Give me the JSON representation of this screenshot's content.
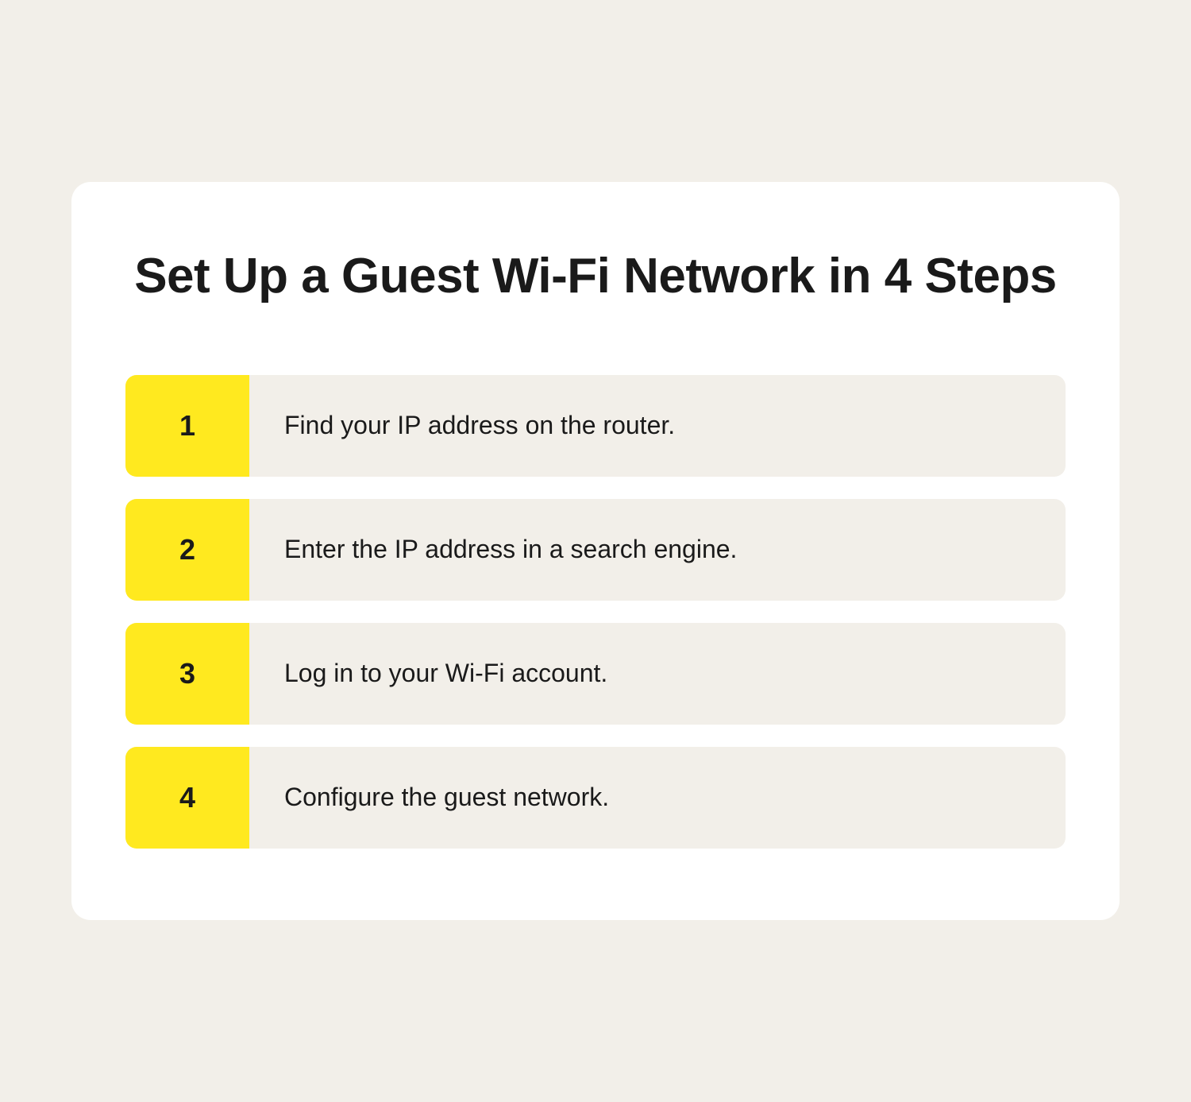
{
  "title": "Set Up a Guest Wi-Fi Network in 4 Steps",
  "colors": {
    "background": "#f2efe9",
    "card": "#ffffff",
    "accent": "#ffe91f",
    "text": "#1a1a1a"
  },
  "steps": [
    {
      "number": "1",
      "text": "Find your IP address on the router."
    },
    {
      "number": "2",
      "text": "Enter the IP address in a search engine."
    },
    {
      "number": "3",
      "text": "Log in to your Wi-Fi account."
    },
    {
      "number": "4",
      "text": "Configure the guest network."
    }
  ]
}
